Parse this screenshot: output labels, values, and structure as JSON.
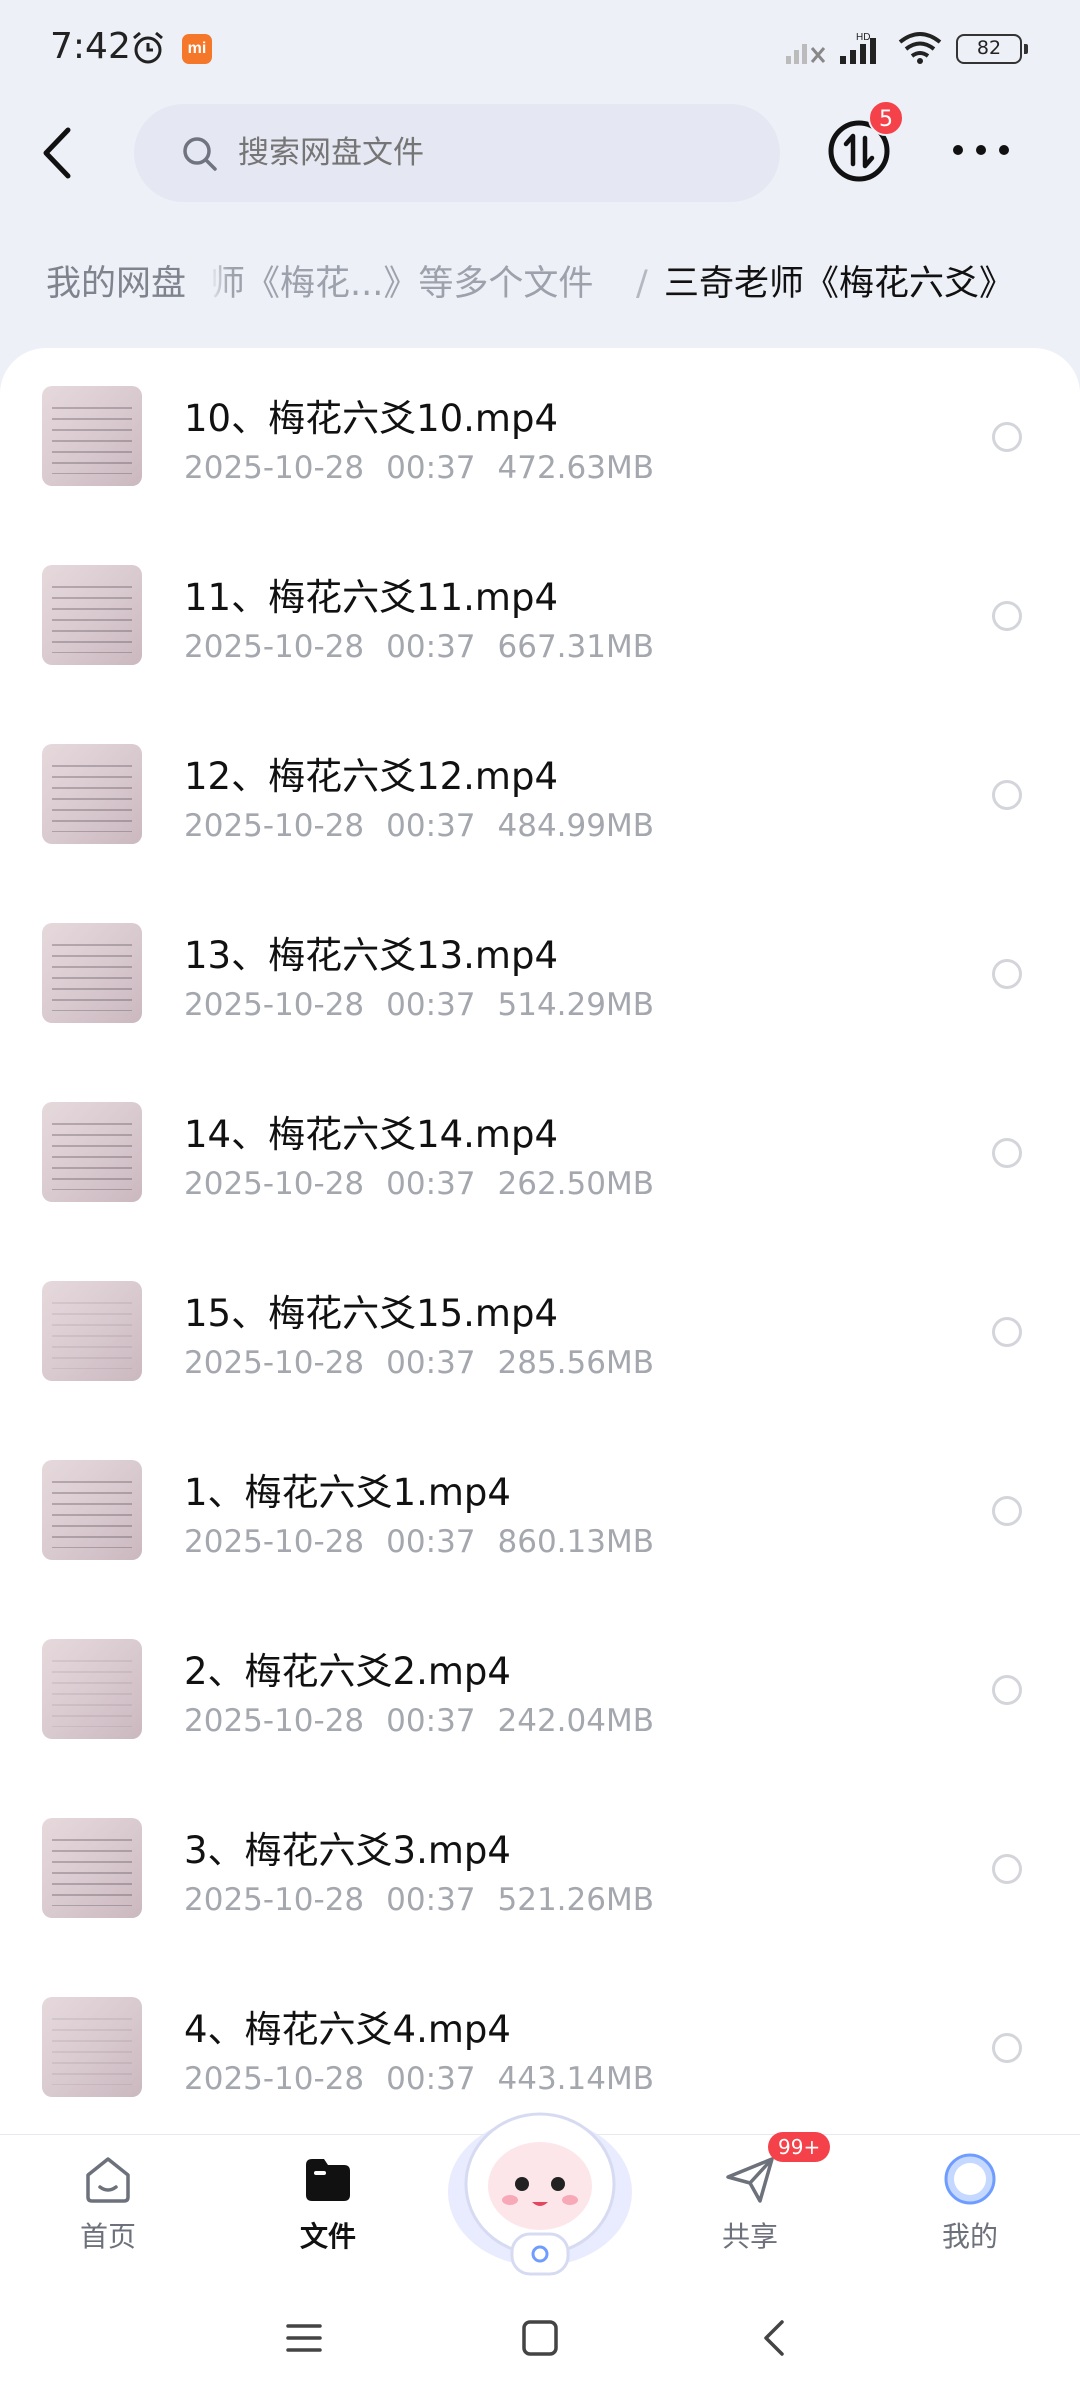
{
  "status_bar": {
    "time": "7:42",
    "mi_label": "mi",
    "hd_label": "HD",
    "battery": "82"
  },
  "header": {
    "search_placeholder": "搜索网盘文件",
    "transfer_badge": "5"
  },
  "breadcrumb": {
    "root": "我的网盘",
    "middle": "师《梅花...》等多个文件",
    "separator": "/",
    "current": "三奇老师《梅花六爻》"
  },
  "files": [
    {
      "name": "10、梅花六爻10.mp4",
      "date": "2025-10-28",
      "time": "00:37",
      "size": "472.63MB"
    },
    {
      "name": "11、梅花六爻11.mp4",
      "date": "2025-10-28",
      "time": "00:37",
      "size": "667.31MB"
    },
    {
      "name": "12、梅花六爻12.mp4",
      "date": "2025-10-28",
      "time": "00:37",
      "size": "484.99MB"
    },
    {
      "name": "13、梅花六爻13.mp4",
      "date": "2025-10-28",
      "time": "00:37",
      "size": "514.29MB"
    },
    {
      "name": "14、梅花六爻14.mp4",
      "date": "2025-10-28",
      "time": "00:37",
      "size": "262.50MB"
    },
    {
      "name": "15、梅花六爻15.mp4",
      "date": "2025-10-28",
      "time": "00:37",
      "size": "285.56MB"
    },
    {
      "name": "1、梅花六爻1.mp4",
      "date": "2025-10-28",
      "time": "00:37",
      "size": "860.13MB"
    },
    {
      "name": "2、梅花六爻2.mp4",
      "date": "2025-10-28",
      "time": "00:37",
      "size": "242.04MB"
    },
    {
      "name": "3、梅花六爻3.mp4",
      "date": "2025-10-28",
      "time": "00:37",
      "size": "521.26MB"
    },
    {
      "name": "4、梅花六爻4.mp4",
      "date": "2025-10-28",
      "time": "00:37",
      "size": "443.14MB"
    }
  ],
  "bottom_nav": {
    "home": "首页",
    "files": "文件",
    "share": "共享",
    "share_badge": "99+",
    "mine": "我的"
  },
  "colors": {
    "accent_badge": "#f5424a",
    "page_bg": "#eef0f7",
    "meta_text": "#a4a7ae"
  }
}
